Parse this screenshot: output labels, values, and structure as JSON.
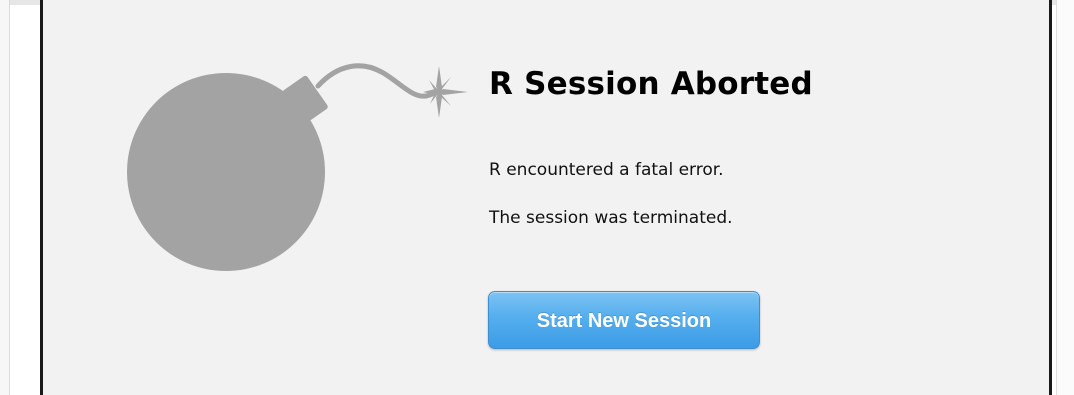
{
  "dialog": {
    "title": "R Session Aborted",
    "message_line_1": "R encountered a fatal error.",
    "message_line_2": "The session was terminated.",
    "button_label": "Start New Session"
  },
  "icons": {
    "illustration": "bomb-icon"
  },
  "colors": {
    "panel_background": "#f2f2f2",
    "bomb": "#a3a3a3",
    "button_blue": "#4aa6ec",
    "button_text": "#ffffff"
  }
}
